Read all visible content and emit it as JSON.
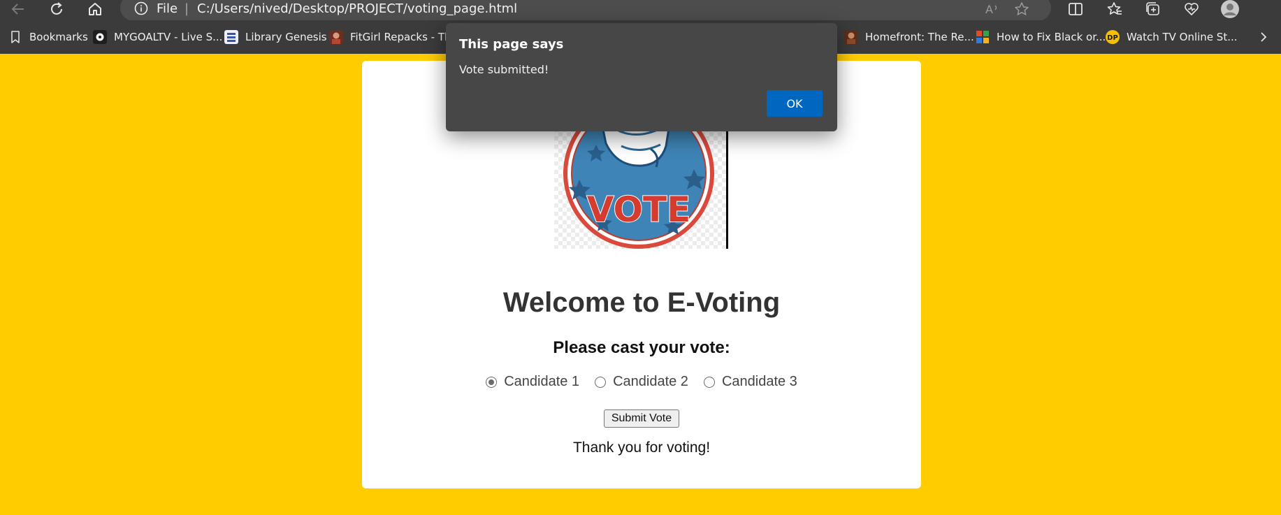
{
  "browser": {
    "address": {
      "scheme_label": "File",
      "separator": "|",
      "url": "C:/Users/nived/Desktop/PROJECT/voting_page.html"
    },
    "bookmarks": [
      {
        "label": "Bookmarks",
        "icon": "bookmark-folder-icon",
        "color": "#cfcfcf"
      },
      {
        "label": "MYGOALTV - Live S...",
        "icon": "mygoaltv-icon",
        "color": "#222222"
      },
      {
        "label": "Library Genesis",
        "icon": "library-genesis-icon",
        "color": "#e8e8f5"
      },
      {
        "label": "FitGirl Repacks - Th...",
        "icon": "fitgirl-icon",
        "color": "#b5472f"
      },
      {
        "label": "Homefront: The Re...",
        "icon": "homefront-icon",
        "color": "#8b4a2b"
      },
      {
        "label": "How to Fix Black or...",
        "icon": "howto-icon",
        "color": "#3aa04a"
      },
      {
        "label": "Watch TV Online St...",
        "icon": "dp-icon",
        "color": "#f5c000"
      }
    ]
  },
  "page": {
    "logo_text": "VOTE",
    "heading": "Welcome to E-Voting",
    "prompt": "Please cast your vote:",
    "candidates": [
      {
        "label": "Candidate 1",
        "selected": true
      },
      {
        "label": "Candidate 2",
        "selected": false
      },
      {
        "label": "Candidate 3",
        "selected": false
      }
    ],
    "submit_label": "Submit Vote",
    "thanks": "Thank you for voting!"
  },
  "dialog": {
    "title": "This page says",
    "message": "Vote submitted!",
    "ok_label": "OK"
  },
  "colors": {
    "page_background": "#ffcc00",
    "dialog_button": "#0067c0",
    "chrome_background": "#3b3b3b"
  }
}
